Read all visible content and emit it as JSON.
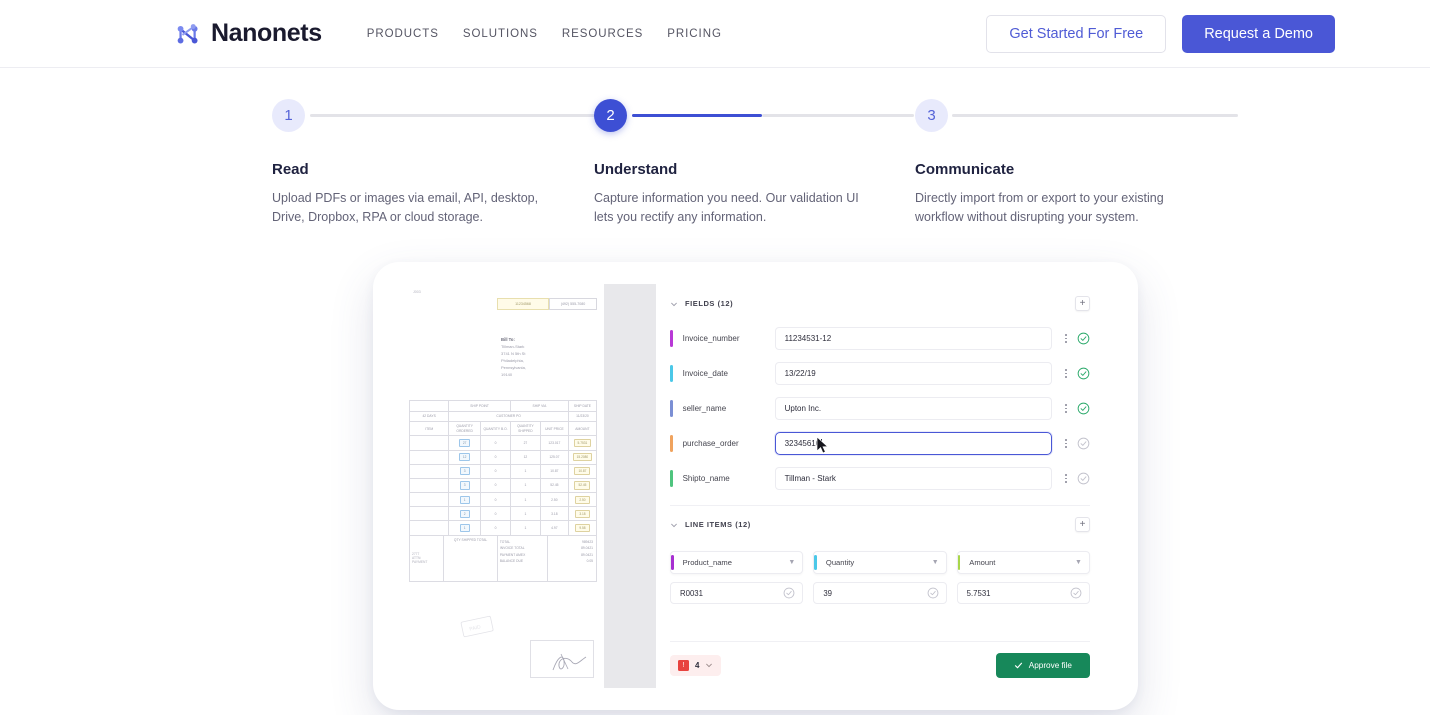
{
  "header": {
    "logo_text": "Nanonets",
    "logo_icon": "nanonets-node-n-logo",
    "nav": [
      {
        "label": "PRODUCTS"
      },
      {
        "label": "SOLUTIONS"
      },
      {
        "label": "RESOURCES"
      },
      {
        "label": "PRICING"
      }
    ],
    "cta_secondary": "Get Started For Free",
    "cta_primary": "Request a Demo"
  },
  "stepper": {
    "steps": [
      {
        "number": "1",
        "title": "Read",
        "desc": "Upload PDFs or images via email, API, desktop, Drive, Dropbox, RPA or cloud storage.",
        "state": "inactive"
      },
      {
        "number": "2",
        "title": "Understand",
        "desc": "Capture information you need. Our validation UI lets you rectify any information.",
        "state": "active"
      },
      {
        "number": "3",
        "title": "Communicate",
        "desc": "Directly import from or export to your existing workflow without disrupting your system.",
        "state": "inactive"
      }
    ]
  },
  "app": {
    "document": {
      "top_code": "J003",
      "code_box": "11234568",
      "phone_box": "(492) 555-7080",
      "billto_label": "Bill To:",
      "billto_lines": [
        "Tillman-Stark",
        "3741 N 5th St",
        "Philadelphia,",
        "Pennsylvania,",
        "19140"
      ],
      "table_head_1": [
        "",
        "SHIP POINT",
        "SHIP VIA",
        "SHIP DATE"
      ],
      "table_head_2": [
        "42 DAYS",
        "CUSTOMER PO",
        "11/23/20"
      ],
      "table_columns": [
        "ITEM",
        "QUANTITY ORDERED",
        "QUANTITY B.O.",
        "QUANTITY SHIPPED",
        "UNIT PRICE",
        "AMOUNT"
      ],
      "table_rows": [
        {
          "ordered": "27",
          "bo": "0",
          "shipped": "27",
          "price": "123.017",
          "amount": "5.7531"
        },
        {
          "ordered": "12",
          "bo": "0",
          "shipped": "12",
          "price": "125.07",
          "amount": "15.2080"
        },
        {
          "ordered": "3",
          "bo": "0",
          "shipped": "1",
          "price": "10.87",
          "amount": "10.87"
        },
        {
          "ordered": "3",
          "bo": "0",
          "shipped": "1",
          "price": "52.45",
          "amount": "52.45"
        },
        {
          "ordered": "1",
          "bo": "0",
          "shipped": "1",
          "price": "2.50",
          "amount": "2.50"
        },
        {
          "ordered": "2",
          "bo": "0",
          "shipped": "1",
          "price": "3.18",
          "amount": "3.18"
        },
        {
          "ordered": "1",
          "bo": "0",
          "shipped": "1",
          "price": "4.97",
          "amount": "9.58"
        }
      ],
      "footer_labels": [
        "QTY SHIPPED TOTAL",
        "TOTAL",
        "INVOICE TOTAL",
        "PAYMENT AMEX",
        "BALANCE DUE"
      ],
      "footer_values": [
        "989423",
        "89.0421",
        "89.0421",
        "0.05"
      ],
      "footer_left": [
        "2777",
        "ATTN:",
        "PAYMENT"
      ]
    },
    "fields_section": {
      "title": "FIELDS (12)",
      "add_label": "+",
      "rows": [
        {
          "name": "Invoice_number",
          "value": "11234531-12",
          "accent": "#b839d6",
          "verified": true,
          "focused": false
        },
        {
          "name": "Invoice_date",
          "value": "13/22/19",
          "accent": "#4bc8e8",
          "verified": true,
          "focused": false
        },
        {
          "name": "seller_name",
          "value": "Upton Inc.",
          "accent": "#7b8fd4",
          "verified": true,
          "focused": false
        },
        {
          "name": "purchase_order",
          "value": "32345610",
          "accent": "#f0a35e",
          "verified": false,
          "focused": true
        },
        {
          "name": "Shipto_name",
          "value": "Tillman - Stark",
          "accent": "#4fc47e",
          "verified": false,
          "focused": false
        }
      ]
    },
    "line_items_section": {
      "title": "LINE ITEMS (12)",
      "add_label": "+",
      "columns": [
        {
          "label": "Product_name",
          "accent": "#a72fd1",
          "value": "R0031"
        },
        {
          "label": "Quantity",
          "accent": "#4bc8e8",
          "value": "39"
        },
        {
          "label": "Amount",
          "accent": "#a8d64a",
          "value": "5.7531"
        }
      ]
    },
    "bottom": {
      "error_count": "4",
      "error_icon": "error-flag-icon",
      "approve_label": "Approve file",
      "approve_icon": "check-icon"
    }
  },
  "colors": {
    "brand_blue": "#4a57d6",
    "approve_green": "#17885a",
    "error_red": "#e8433f"
  }
}
